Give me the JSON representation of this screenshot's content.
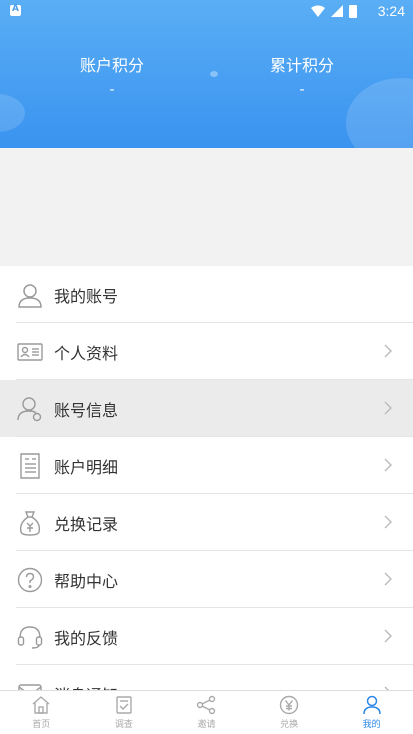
{
  "status_bar": {
    "time": "3:24",
    "notification_badge": "A"
  },
  "header": {
    "account_points_label": "账户积分",
    "account_points_value": "-",
    "total_points_label": "累计积分",
    "total_points_value": "-"
  },
  "menu": {
    "items": [
      {
        "label": "我的账号",
        "icon": "user-icon",
        "has_chevron": false
      },
      {
        "label": "个人资料",
        "icon": "id-card-icon",
        "has_chevron": true
      },
      {
        "label": "账号信息",
        "icon": "user-settings-icon",
        "has_chevron": true
      },
      {
        "label": "账户明细",
        "icon": "receipt-icon",
        "has_chevron": true
      },
      {
        "label": "兑换记录",
        "icon": "money-bag-icon",
        "has_chevron": true
      },
      {
        "label": "帮助中心",
        "icon": "help-icon",
        "has_chevron": true
      },
      {
        "label": "我的反馈",
        "icon": "headset-icon",
        "has_chevron": true
      },
      {
        "label": "消息通知",
        "icon": "message-icon",
        "has_chevron": true
      }
    ]
  },
  "nav": {
    "items": [
      {
        "label": "首页",
        "icon": "home-icon"
      },
      {
        "label": "调查",
        "icon": "survey-icon"
      },
      {
        "label": "邀请",
        "icon": "share-icon"
      },
      {
        "label": "兑换",
        "icon": "yen-icon"
      },
      {
        "label": "我的",
        "icon": "profile-icon"
      }
    ],
    "active": "我的"
  },
  "colors": {
    "header_top": "#5aaef5",
    "header_bottom": "#3a93ef",
    "nav_active": "#2c87e8",
    "icon_gray": "#9a9a9a"
  }
}
